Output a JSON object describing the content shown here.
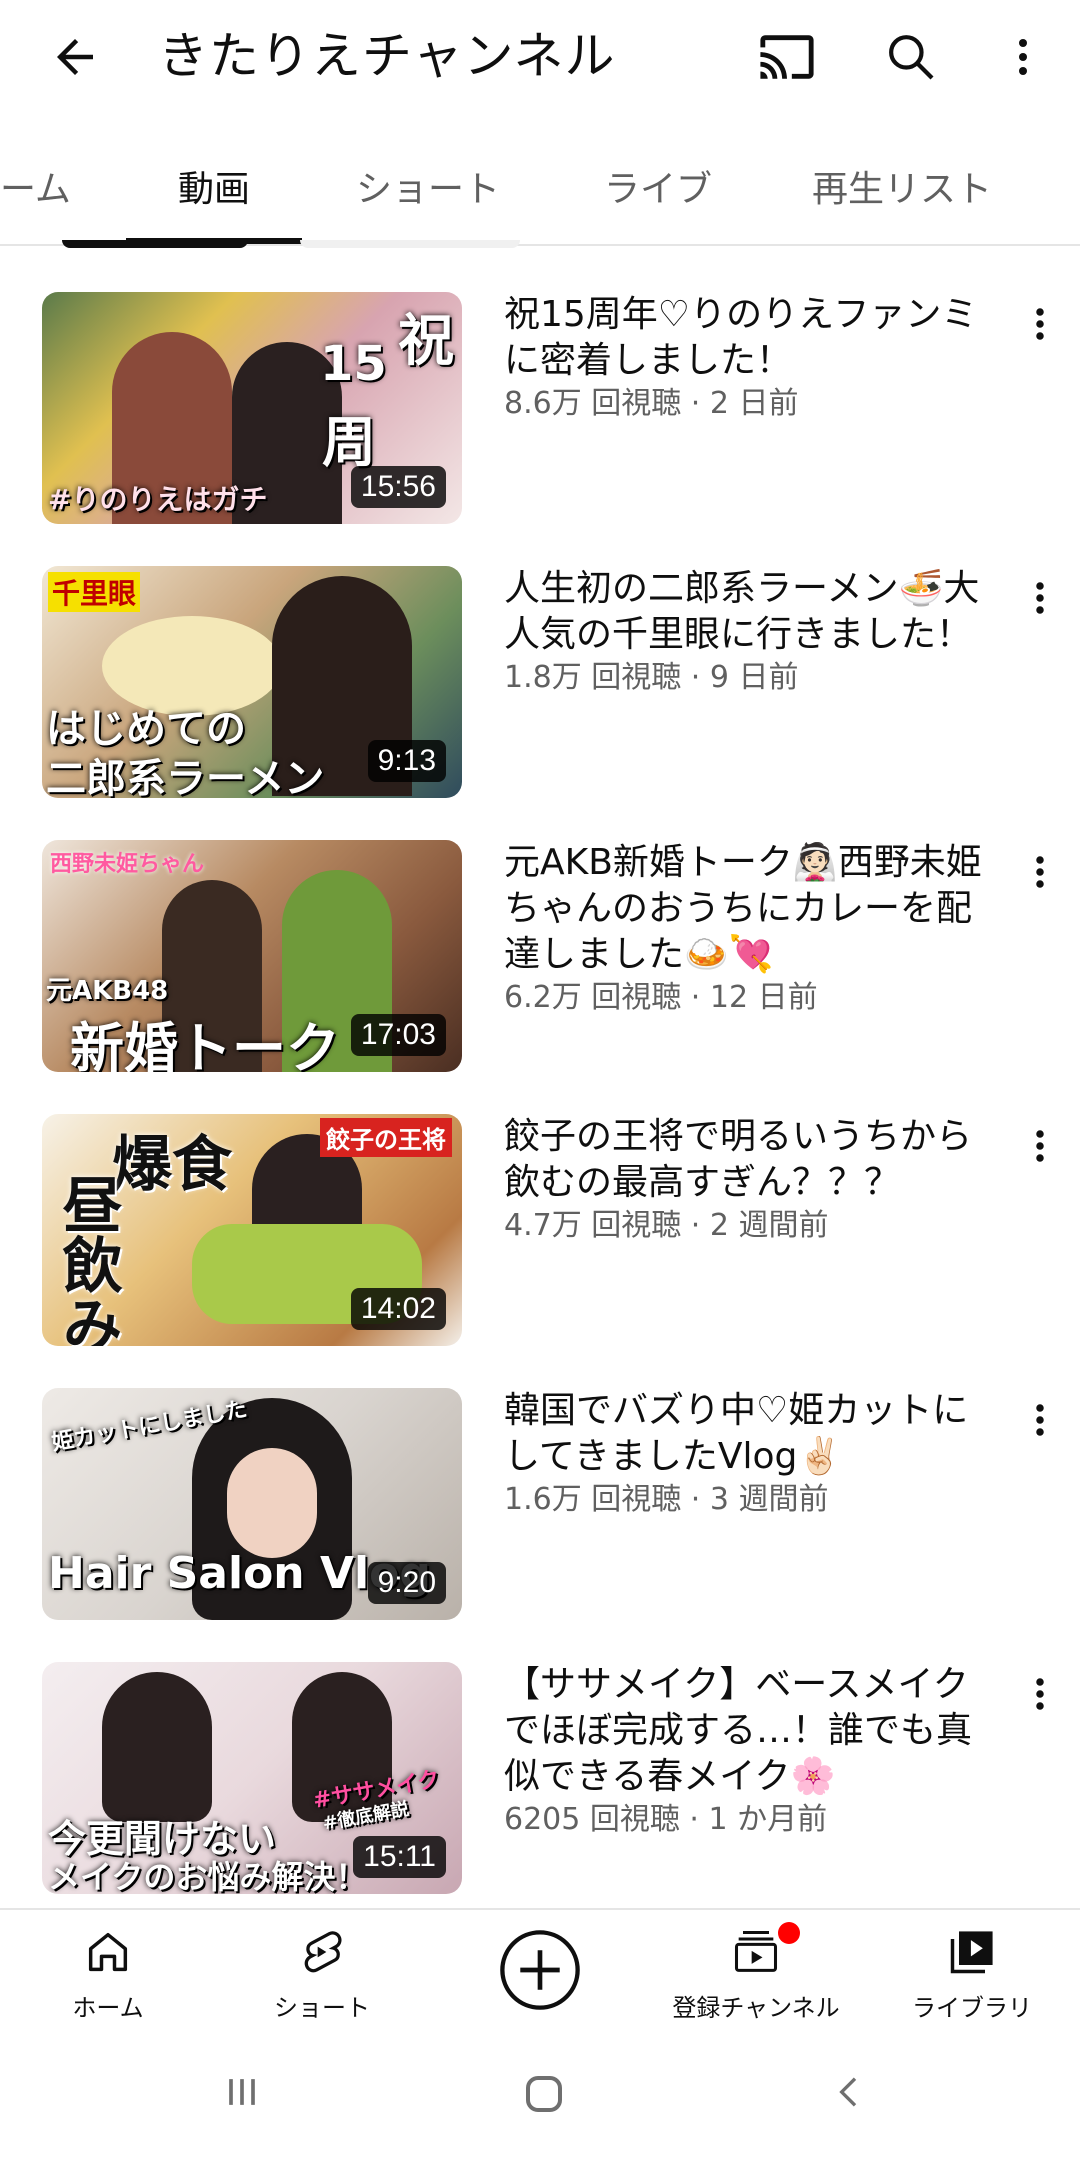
{
  "header": {
    "title": "きたりえチャンネル"
  },
  "tabs": [
    {
      "label": "ーム"
    },
    {
      "label": "動画"
    },
    {
      "label": "ショート"
    },
    {
      "label": "ライブ"
    },
    {
      "label": "再生リスト"
    }
  ],
  "videos": [
    {
      "title": "祝15周年♡りのりえファンミに密着しました！",
      "info": "8.6万 回視聴 · 2 日前",
      "duration": "15:56",
      "thumb_text": [
        "#りのりえはガチ",
        "祝",
        "15",
        "周"
      ],
      "thumb_color": "#d8a4b0"
    },
    {
      "title": "人生初の二郎系ラーメン🍜大人気の千里眼に行きました！",
      "info": "1.8万 回視聴 · 9 日前",
      "duration": "9:13",
      "thumb_text": [
        "千里眼",
        "はじめての",
        "二郎系ラーメン"
      ],
      "thumb_color": "#c9a57c"
    },
    {
      "title": "元AKB新婚トーク👰🏻西野未姫ちゃんのおうちにカレーを配達しました🍛💘",
      "info": "6.2万 回視聴 · 12 日前",
      "duration": "17:03",
      "thumb_text": [
        "西野未姫ちゃん",
        "元AKB48",
        "新婚トーク"
      ],
      "thumb_color": "#8a5a3e"
    },
    {
      "title": "餃子の王将で明るいうちから飲むの最高すぎん？？？",
      "info": "4.7万 回視聴 · 2 週間前",
      "duration": "14:02",
      "thumb_text": [
        "爆食",
        "昼飲み",
        "餃子の王将"
      ],
      "thumb_color": "#e7c17b"
    },
    {
      "title": "韓国でバズり中♡姫カットにしてきましたVlog✌🏻",
      "info": "1.6万 回視聴 · 3 週間前",
      "duration": "9:20",
      "thumb_text": [
        "姫カットにしました",
        "Hair Salon Vlog"
      ],
      "thumb_color": "#d9d4cf"
    },
    {
      "title": "【ササメイク】ベースメイクでほぼ完成する…！誰でも真似できる春メイク🌸",
      "info": "6205 回視聴 · 1 か月前",
      "duration": "15:11",
      "thumb_text": [
        "#ササメイク",
        "#徹底解説",
        "今更聞けない",
        "メイクのお悩み解決！"
      ],
      "thumb_color": "#e9d9dd"
    }
  ],
  "bottom_nav": [
    {
      "label": "ホーム",
      "icon": "home-icon"
    },
    {
      "label": "ショート",
      "icon": "shorts-icon"
    },
    {
      "label": "",
      "icon": "create-icon"
    },
    {
      "label": "登録チャンネル",
      "icon": "subscriptions-icon"
    },
    {
      "label": "ライブラリ",
      "icon": "library-icon"
    }
  ],
  "colors": {
    "text_primary": "#0f0f0f",
    "text_secondary": "#606060",
    "notification_dot": "#ff0000"
  }
}
